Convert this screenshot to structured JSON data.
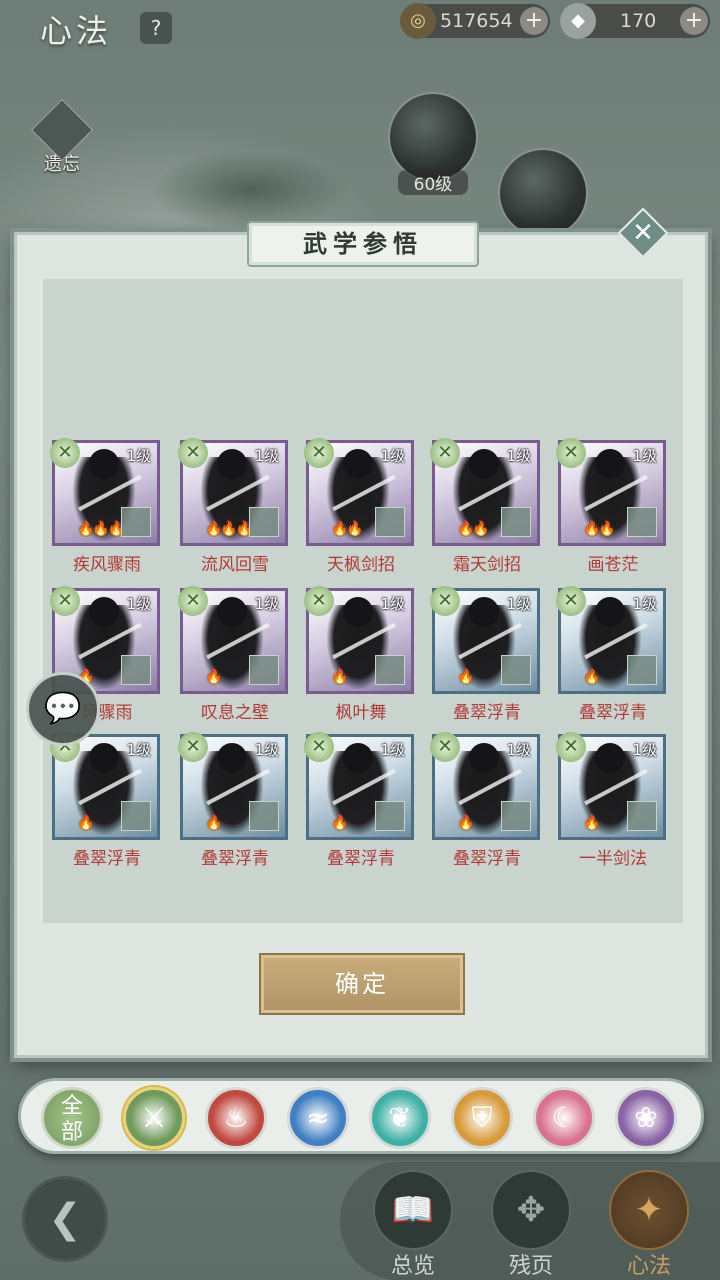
{
  "header": {
    "title": "心法",
    "help": "?",
    "copper": "517654",
    "silver": "170",
    "plus": "+",
    "forget": "遗忘"
  },
  "background": {
    "orb_level": "60级"
  },
  "dialog": {
    "title": "武学参悟",
    "close": "✕",
    "confirm": "确定",
    "skills": [
      {
        "name": "疾风骤雨",
        "level": "1级",
        "flames": "🔥🔥🔥",
        "style": "purple"
      },
      {
        "name": "流风回雪",
        "level": "1级",
        "flames": "🔥🔥🔥",
        "style": "purple"
      },
      {
        "name": "天枫剑招",
        "level": "1级",
        "flames": "🔥🔥",
        "style": "purple"
      },
      {
        "name": "霜天剑招",
        "level": "1级",
        "flames": "🔥🔥",
        "style": "purple"
      },
      {
        "name": "画苍茫",
        "level": "1级",
        "flames": "🔥🔥",
        "style": "purple"
      },
      {
        "name": "风骤雨",
        "level": "1级",
        "flames": "🔥",
        "style": "purple"
      },
      {
        "name": "叹息之壁",
        "level": "1级",
        "flames": "🔥",
        "style": "purple"
      },
      {
        "name": "枫叶舞",
        "level": "1级",
        "flames": "🔥",
        "style": "purple"
      },
      {
        "name": "叠翠浮青",
        "level": "1级",
        "flames": "🔥",
        "style": "blue"
      },
      {
        "name": "叠翠浮青",
        "level": "1级",
        "flames": "🔥",
        "style": "blue"
      },
      {
        "name": "叠翠浮青",
        "level": "1级",
        "flames": "🔥",
        "style": "blue"
      },
      {
        "name": "叠翠浮青",
        "level": "1级",
        "flames": "🔥",
        "style": "blue"
      },
      {
        "name": "叠翠浮青",
        "level": "1级",
        "flames": "🔥",
        "style": "blue"
      },
      {
        "name": "叠翠浮青",
        "level": "1级",
        "flames": "🔥",
        "style": "blue"
      },
      {
        "name": "一半剑法",
        "level": "1级",
        "flames": "🔥",
        "style": "blue"
      }
    ]
  },
  "categories": {
    "all_label": "全部",
    "items": [
      {
        "icon": "sword-icon",
        "color": "#6f9a5c"
      },
      {
        "icon": "flame-icon",
        "color": "#c04a3f"
      },
      {
        "icon": "wave-icon",
        "color": "#3f7fc2"
      },
      {
        "icon": "butterfly-icon",
        "color": "#3fb0a5"
      },
      {
        "icon": "shield-icon",
        "color": "#d79a3a"
      },
      {
        "icon": "moon-icon",
        "color": "#d9728f"
      },
      {
        "icon": "rose-icon",
        "color": "#8a63a6"
      }
    ]
  },
  "nav": {
    "overview": "总览",
    "fragments": "残页",
    "xinfa": "心法"
  }
}
